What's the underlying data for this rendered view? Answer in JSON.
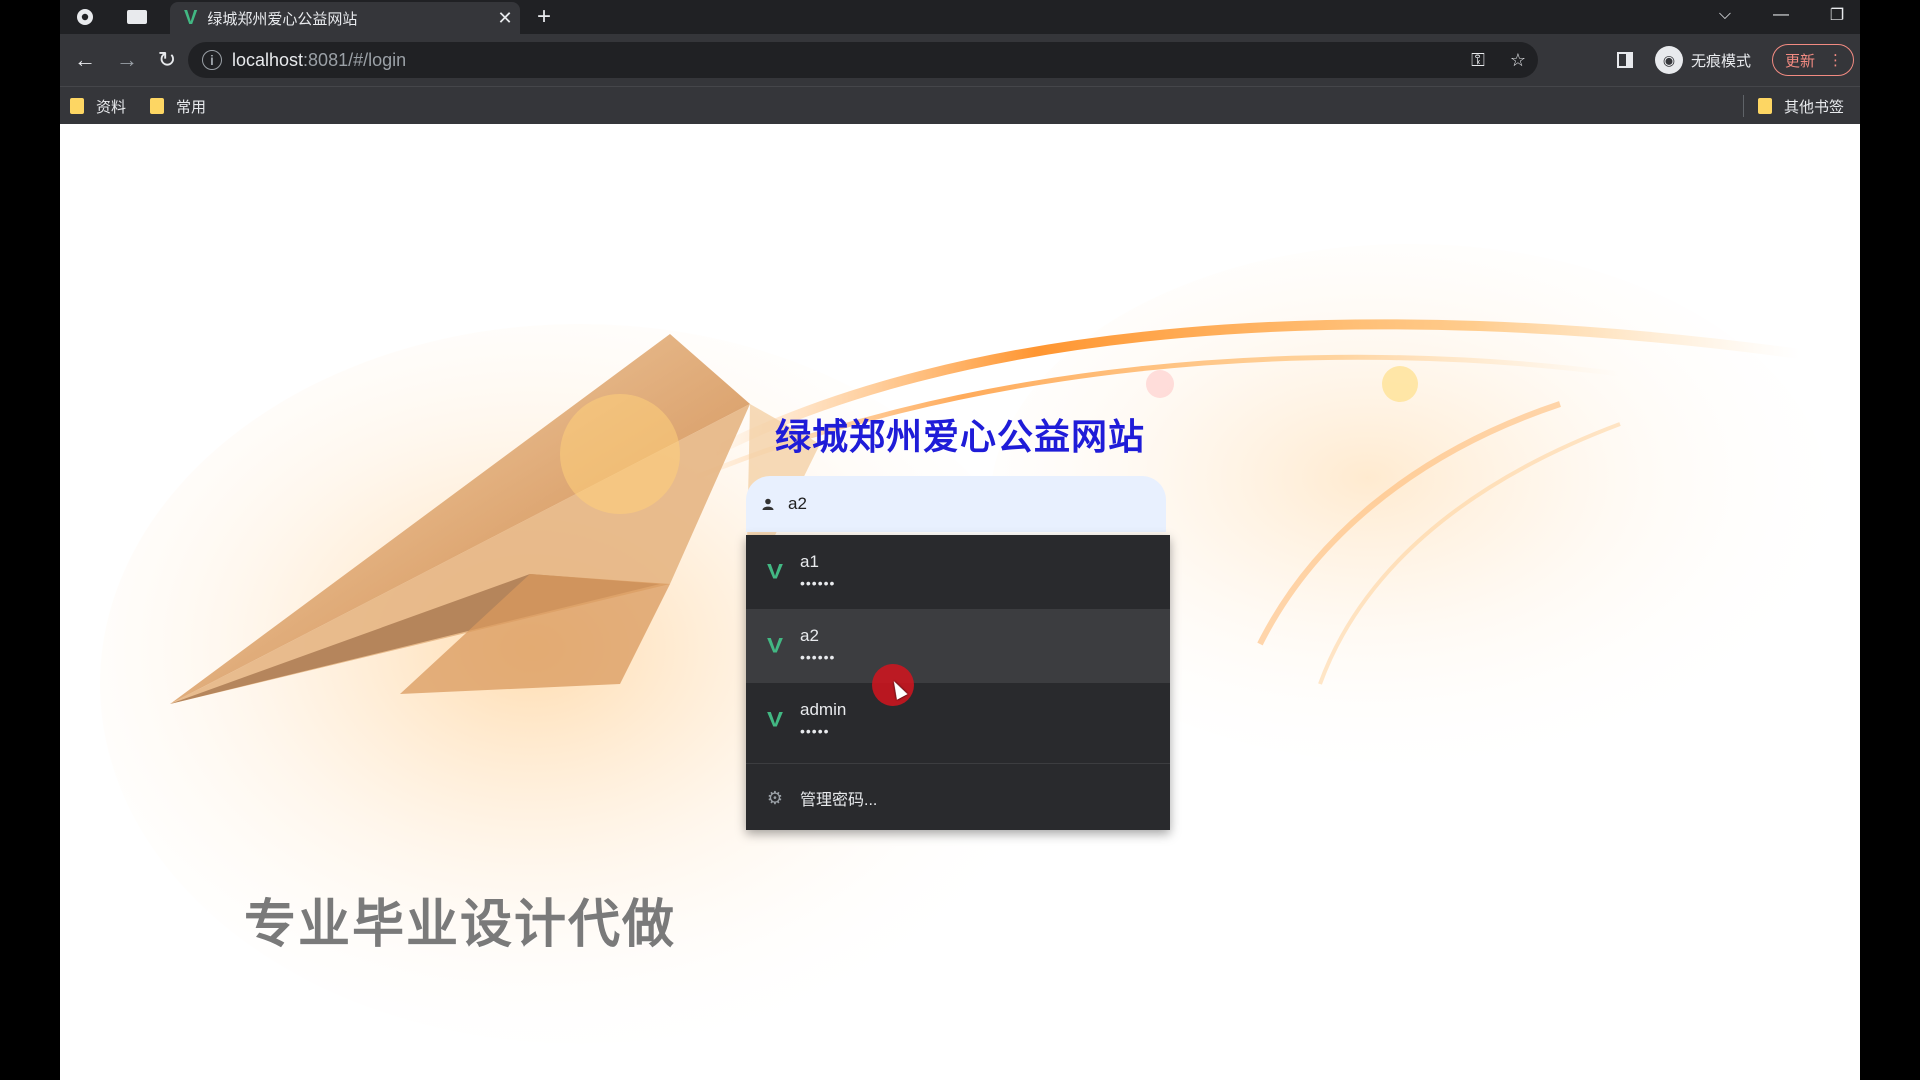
{
  "browser": {
    "tab": {
      "title": "绿城郑州爱心公益网站",
      "favicon": "V"
    },
    "address": {
      "host": "localhost",
      "rest": ":8081/#/login"
    },
    "incognito_label": "无痕模式",
    "update_label": "更新",
    "bookmarks": [
      {
        "label": "资料"
      },
      {
        "label": "常用"
      }
    ],
    "other_bookmarks": "其他书签"
  },
  "page": {
    "title": "绿城郑州爱心公益网站",
    "slogan": "专业毕业设计代做",
    "username_value": "a2"
  },
  "autofill": {
    "items": [
      {
        "name": "a1",
        "password_mask": "••••••"
      },
      {
        "name": "a2",
        "password_mask": "••••••",
        "highlighted": true
      },
      {
        "name": "admin",
        "password_mask": "•••••"
      }
    ],
    "manage_label": "管理密码..."
  },
  "colors": {
    "title": "#1f1cd8",
    "vue_green": "#42b883",
    "dropdown_bg": "#292a2d"
  }
}
